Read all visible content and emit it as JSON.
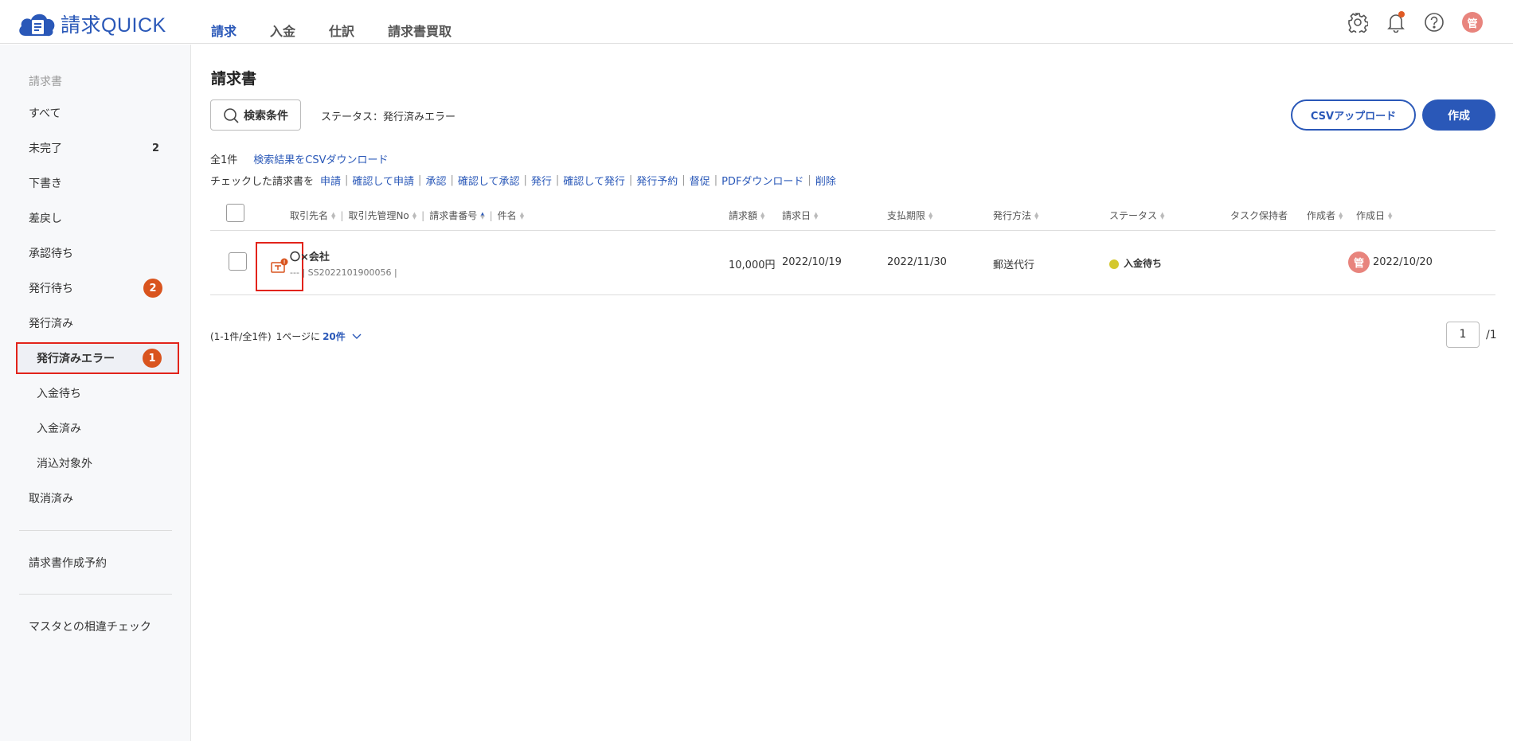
{
  "app": {
    "logo_text": "請求QUICK"
  },
  "nav": {
    "items": [
      {
        "label": "請求",
        "active": true
      },
      {
        "label": "入金",
        "active": false
      },
      {
        "label": "仕訳",
        "active": false
      },
      {
        "label": "請求書買取",
        "active": false
      }
    ]
  },
  "header_icons": {
    "settings": "gear-icon",
    "notifications": "bell-icon",
    "help": "question-icon",
    "avatar_text": "管"
  },
  "sidebar": {
    "section_title": "請求書",
    "items": [
      {
        "label": "すべて",
        "count": "",
        "badge": ""
      },
      {
        "label": "未完了",
        "count": "2",
        "badge": ""
      },
      {
        "label": "下書き",
        "count": "",
        "badge": ""
      },
      {
        "label": "差戻し",
        "count": "",
        "badge": ""
      },
      {
        "label": "承認待ち",
        "count": "",
        "badge": ""
      },
      {
        "label": "発行待ち",
        "count": "",
        "badge": "2"
      },
      {
        "label": "発行済み",
        "count": "",
        "badge": ""
      },
      {
        "label": "発行済みエラー",
        "count": "",
        "badge": "1"
      },
      {
        "label": "入金待ち",
        "count": "",
        "badge": ""
      },
      {
        "label": "入金済み",
        "count": "",
        "badge": ""
      },
      {
        "label": "消込対象外",
        "count": "",
        "badge": ""
      },
      {
        "label": "取消済み",
        "count": "",
        "badge": ""
      }
    ],
    "schedule_label": "請求書作成予約",
    "master_check_label": "マスタとの相違チェック"
  },
  "main": {
    "title": "請求書",
    "search_button": "検索条件",
    "filter_status": "ステータス：発行済みエラー",
    "csv_upload_button": "CSVアップロード",
    "create_button": "作成",
    "total_label": "全1件",
    "csv_download_link": "検索結果をCSVダウンロード",
    "checked_label": "チェックした請求書を",
    "actions": [
      "申請",
      "確認して申請",
      "承認",
      "確認して承認",
      "発行",
      "確認して発行",
      "発行予約",
      "督促",
      "PDFダウンロード",
      "削除"
    ]
  },
  "table": {
    "headers": {
      "client": "取引先名",
      "client_no": "取引先管理No",
      "invoice_no": "請求書番号",
      "subject": "件名",
      "amount": "請求額",
      "invoice_date": "請求日",
      "due_date": "支払期限",
      "method": "発行方法",
      "status": "ステータス",
      "task_holder": "タスク保持者",
      "creator": "作成者",
      "created_date": "作成日"
    },
    "rows": [
      {
        "client": "〇×会社",
        "sub_info": "--- | SS2022101900056 |",
        "amount": "10,000円",
        "invoice_date": "2022/10/19",
        "due_date": "2022/11/30",
        "method": "郵送代行",
        "status": "入金待ち",
        "creator": "管",
        "created_date": "2022/10/20"
      }
    ]
  },
  "pager": {
    "range": "(1-1件/全1件)",
    "per_page_label": "1ページに",
    "per_page_value": "20件",
    "current_page": "1",
    "total_pages": "/1"
  }
}
